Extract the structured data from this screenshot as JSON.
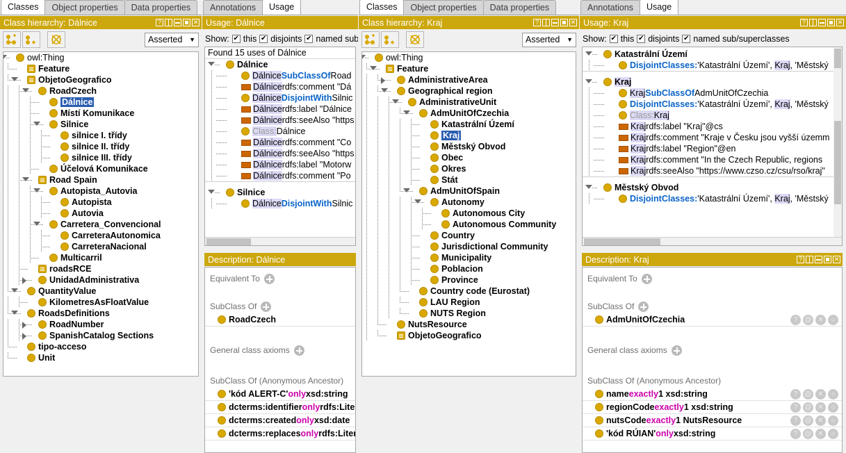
{
  "panel1": {
    "tabs": [
      {
        "label": "Classes",
        "active": true
      },
      {
        "label": "Object properties",
        "active": false
      },
      {
        "label": "Data properties",
        "active": false
      }
    ],
    "title": "Class hierarchy: Dálnice",
    "toolbar": {
      "add_subclass_icon": "add-subclass-icon",
      "add_sibling_icon": "add-sibling-class-icon",
      "delete_icon": "delete-class-icon",
      "reasoner_mode": "Asserted"
    },
    "tree": [
      {
        "label": "owl:Thing",
        "depth": 0,
        "arrow": "down",
        "node": "class",
        "bold": false
      },
      {
        "label": "Feature",
        "depth": 1,
        "arrow": "",
        "node": "defined",
        "bold": true
      },
      {
        "label": "ObjetoGeografico",
        "depth": 1,
        "arrow": "down",
        "node": "defined",
        "bold": true
      },
      {
        "label": "RoadCzech",
        "depth": 2,
        "arrow": "down",
        "node": "class",
        "bold": true
      },
      {
        "label": "Dálnice",
        "depth": 3,
        "arrow": "",
        "node": "class",
        "bold": true,
        "selected": true
      },
      {
        "label": "Místí Komunikace",
        "depth": 3,
        "arrow": "",
        "node": "class",
        "bold": true
      },
      {
        "label": "Silnice",
        "depth": 3,
        "arrow": "down",
        "node": "class",
        "bold": true
      },
      {
        "label": "silnice I. třídy",
        "depth": 4,
        "arrow": "",
        "node": "class",
        "bold": true
      },
      {
        "label": "silnice II. třídy",
        "depth": 4,
        "arrow": "",
        "node": "class",
        "bold": true
      },
      {
        "label": "silnice III. třídy",
        "depth": 4,
        "arrow": "",
        "node": "class",
        "bold": true
      },
      {
        "label": "Účelová Komunikace",
        "depth": 3,
        "arrow": "",
        "node": "class",
        "bold": true
      },
      {
        "label": "Road Spain",
        "depth": 2,
        "arrow": "down",
        "node": "defined",
        "bold": true
      },
      {
        "label": "Autopista_Autovia",
        "depth": 3,
        "arrow": "down",
        "node": "class",
        "bold": true
      },
      {
        "label": "Autopista",
        "depth": 4,
        "arrow": "",
        "node": "class",
        "bold": true
      },
      {
        "label": "Autovia",
        "depth": 4,
        "arrow": "",
        "node": "class",
        "bold": true
      },
      {
        "label": "Carretera_Convencional",
        "depth": 3,
        "arrow": "down",
        "node": "class",
        "bold": true
      },
      {
        "label": "CarreteraAutonomica",
        "depth": 4,
        "arrow": "",
        "node": "class",
        "bold": true
      },
      {
        "label": "CarreteraNacional",
        "depth": 4,
        "arrow": "",
        "node": "class",
        "bold": true
      },
      {
        "label": "Multicarril",
        "depth": 3,
        "arrow": "",
        "node": "class",
        "bold": true
      },
      {
        "label": "roadsRCE",
        "depth": 2,
        "arrow": "",
        "node": "defined",
        "bold": true
      },
      {
        "label": "UnidadAdministrativa",
        "depth": 2,
        "arrow": "right",
        "node": "class",
        "bold": true
      },
      {
        "label": "QuantityValue",
        "depth": 1,
        "arrow": "down",
        "node": "class",
        "bold": true
      },
      {
        "label": "KilometresAsFloatValue",
        "depth": 2,
        "arrow": "",
        "node": "class",
        "bold": true
      },
      {
        "label": "RoadsDefinitions",
        "depth": 1,
        "arrow": "down",
        "node": "class",
        "bold": true
      },
      {
        "label": "RoadNumber",
        "depth": 2,
        "arrow": "right",
        "node": "class",
        "bold": true
      },
      {
        "label": "SpanishCatalog Sections",
        "depth": 2,
        "arrow": "right",
        "node": "class",
        "bold": true
      },
      {
        "label": "tipo-acceso",
        "depth": 1,
        "arrow": "",
        "node": "class",
        "bold": true
      },
      {
        "label": "Unit",
        "depth": 1,
        "arrow": "",
        "node": "class",
        "bold": true
      }
    ]
  },
  "panel2": {
    "tabs": [
      {
        "label": "Annotations",
        "active": false
      },
      {
        "label": "Usage",
        "active": true
      }
    ],
    "title": "Usage: Dálnice",
    "show": {
      "label": "Show:",
      "opt1": "this",
      "opt2": "disjoints",
      "opt3": "named sub",
      "check": "✔"
    },
    "found": "Found 15 uses of Dálnice",
    "found_term": "Dálnice",
    "rows": [
      {
        "kind": "group",
        "label": "Dálnice",
        "arrow": "down"
      },
      {
        "kind": "axiom",
        "node": "class",
        "subj": "Dálnice",
        "kw": "SubClassOf",
        "rest": "Road"
      },
      {
        "kind": "axiom",
        "node": "anno",
        "subj": "Dálnice",
        "kw": "",
        "rest": "rdfs:comment \"Dá"
      },
      {
        "kind": "axiom",
        "node": "class",
        "subj": "Dálnice",
        "kw": "DisjointWith",
        "rest": "Silnic"
      },
      {
        "kind": "axiom",
        "node": "anno",
        "subj": "Dálnice",
        "kw": "",
        "rest": "rdfs:label \"Dálnice"
      },
      {
        "kind": "axiom",
        "node": "anno",
        "subj": "Dálnice",
        "kw": "",
        "rest": "rdfs:seeAlso \"https"
      },
      {
        "kind": "axiom",
        "node": "class",
        "subj": "Class:",
        "kw": "",
        "rest": "Dálnice",
        "light": true
      },
      {
        "kind": "axiom",
        "node": "anno",
        "subj": "Dálnice",
        "kw": "",
        "rest": "rdfs:comment \"Co"
      },
      {
        "kind": "axiom",
        "node": "anno",
        "subj": "Dálnice",
        "kw": "",
        "rest": "rdfs:seeAlso \"https"
      },
      {
        "kind": "axiom",
        "node": "anno",
        "subj": "Dálnice",
        "kw": "",
        "rest": "rdfs:label \"Motorw"
      },
      {
        "kind": "axiom",
        "node": "anno",
        "subj": "Dálnice",
        "kw": "",
        "rest": "rdfs:comment \"Po"
      },
      {
        "kind": "sep"
      },
      {
        "kind": "group",
        "label": "Silnice",
        "arrow": "down"
      },
      {
        "kind": "axiom",
        "node": "class",
        "subj": "Dálnice",
        "kw": "DisjointWith",
        "rest": "Silnic"
      }
    ]
  },
  "panel2desc": {
    "title": "Description: Dálnice",
    "sections": {
      "equivalent_to": "Equivalent To",
      "subclass_of": "SubClass Of",
      "general_class_axioms": "General class axioms",
      "anon_ancestor": "SubClass Of (Anonymous Ancestor)"
    },
    "subclass_rows": [
      {
        "label": "RoadCzech"
      }
    ],
    "anon_rows": [
      {
        "prefix": "'kód ALERT-C'",
        "kw": "only",
        "suffix": "xsd:string"
      },
      {
        "prefix": "dcterms:identifier",
        "kw": "only",
        "suffix": "rdfs:Liter"
      },
      {
        "prefix": "dcterms:created",
        "kw": "only",
        "suffix": "xsd:date"
      },
      {
        "prefix": "dcterms:replaces",
        "kw": "only",
        "suffix": "rdfs:Liter"
      }
    ]
  },
  "panel3": {
    "tabs": [
      {
        "label": "Classes",
        "active": true
      },
      {
        "label": "Object properties",
        "active": false
      },
      {
        "label": "Data properties",
        "active": false
      }
    ],
    "title": "Class hierarchy: Kraj",
    "toolbar": {
      "add_subclass_icon": "add-subclass-icon",
      "add_sibling_icon": "add-sibling-class-icon",
      "delete_icon": "delete-class-icon",
      "reasoner_mode": "Asserted"
    },
    "tree": [
      {
        "label": "owl:Thing",
        "depth": 0,
        "arrow": "down",
        "node": "class",
        "bold": false
      },
      {
        "label": "Feature",
        "depth": 1,
        "arrow": "down",
        "node": "defined",
        "bold": true
      },
      {
        "label": "AdministrativeArea",
        "depth": 2,
        "arrow": "right",
        "node": "class",
        "bold": true
      },
      {
        "label": "Geographical region",
        "depth": 2,
        "arrow": "down",
        "node": "class",
        "bold": true
      },
      {
        "label": "AdministrativeUnit",
        "depth": 3,
        "arrow": "down",
        "node": "class",
        "bold": true
      },
      {
        "label": "AdmUnitOfCzechia",
        "depth": 4,
        "arrow": "down",
        "node": "class",
        "bold": true
      },
      {
        "label": "Katastrální Území",
        "depth": 5,
        "arrow": "",
        "node": "class",
        "bold": true
      },
      {
        "label": "Kraj",
        "depth": 5,
        "arrow": "",
        "node": "class",
        "bold": true,
        "selected": true
      },
      {
        "label": "Městský Obvod",
        "depth": 5,
        "arrow": "",
        "node": "class",
        "bold": true
      },
      {
        "label": "Obec",
        "depth": 5,
        "arrow": "",
        "node": "class",
        "bold": true
      },
      {
        "label": "Okres",
        "depth": 5,
        "arrow": "",
        "node": "class",
        "bold": true
      },
      {
        "label": "Stát",
        "depth": 5,
        "arrow": "",
        "node": "class",
        "bold": true
      },
      {
        "label": "AdmUnitOfSpain",
        "depth": 4,
        "arrow": "down",
        "node": "class",
        "bold": true
      },
      {
        "label": "Autonomy",
        "depth": 5,
        "arrow": "down",
        "node": "class",
        "bold": true
      },
      {
        "label": "Autonomous City",
        "depth": 6,
        "arrow": "",
        "node": "class",
        "bold": true
      },
      {
        "label": "Autonomous Community",
        "depth": 6,
        "arrow": "",
        "node": "class",
        "bold": true
      },
      {
        "label": "Country",
        "depth": 5,
        "arrow": "",
        "node": "class",
        "bold": true
      },
      {
        "label": "Jurisdictional Community",
        "depth": 5,
        "arrow": "",
        "node": "class",
        "bold": true
      },
      {
        "label": "Municipality",
        "depth": 5,
        "arrow": "",
        "node": "class",
        "bold": true
      },
      {
        "label": "Poblacion",
        "depth": 5,
        "arrow": "",
        "node": "class",
        "bold": true
      },
      {
        "label": "Province",
        "depth": 5,
        "arrow": "",
        "node": "class",
        "bold": true
      },
      {
        "label": "Country code (Eurostat)",
        "depth": 4,
        "arrow": "",
        "node": "class",
        "bold": true
      },
      {
        "label": "LAU Region",
        "depth": 4,
        "arrow": "",
        "node": "class",
        "bold": true
      },
      {
        "label": "NUTS Region",
        "depth": 4,
        "arrow": "",
        "node": "class",
        "bold": true
      },
      {
        "label": "NutsResource",
        "depth": 2,
        "arrow": "",
        "node": "class",
        "bold": true
      },
      {
        "label": "ObjetoGeografico",
        "depth": 2,
        "arrow": "",
        "node": "defined",
        "bold": true
      }
    ]
  },
  "panel4": {
    "tabs": [
      {
        "label": "Annotations",
        "active": false
      },
      {
        "label": "Usage",
        "active": true
      }
    ],
    "title": "Usage: Kraj",
    "show": {
      "label": "Show:",
      "opt1": "this",
      "opt2": "disjoints",
      "opt3": "named sub/superclasses",
      "check": "✔"
    },
    "rows": [
      {
        "kind": "group",
        "label": "Katastrální Území",
        "arrow": "down"
      },
      {
        "kind": "axiom",
        "node": "class",
        "subj": "",
        "kw": "DisjointClasses:",
        "rest": "'Katastrální Území', Kraj, 'Městský",
        "hlword": "Kraj"
      },
      {
        "kind": "sep"
      },
      {
        "kind": "group",
        "label": "Kraj",
        "arrow": "down",
        "hl": true
      },
      {
        "kind": "axiom",
        "node": "class",
        "subj": "Kraj",
        "kw": "SubClassOf",
        "rest": "AdmUnitOfCzechia"
      },
      {
        "kind": "axiom",
        "node": "class",
        "subj": "",
        "kw": "DisjointClasses:",
        "rest": "'Katastrální Území', Kraj, 'Městský",
        "hlword": "Kraj"
      },
      {
        "kind": "axiom",
        "node": "class",
        "subj": "Class:",
        "kw": "",
        "rest": "Kraj",
        "light": true,
        "hlword": "Kraj"
      },
      {
        "kind": "axiom",
        "node": "anno",
        "subj": "Kraj",
        "kw": "",
        "rest": "rdfs:label \"Kraj\"@cs"
      },
      {
        "kind": "axiom",
        "node": "anno",
        "subj": "Kraj",
        "kw": "",
        "rest": "rdfs:comment \"Kraje v Česku jsou vyšší územm"
      },
      {
        "kind": "axiom",
        "node": "anno",
        "subj": "Kraj",
        "kw": "",
        "rest": "rdfs:label \"Region\"@en"
      },
      {
        "kind": "axiom",
        "node": "anno",
        "subj": "Kraj",
        "kw": "",
        "rest": "rdfs:comment \"In the Czech Republic, regions "
      },
      {
        "kind": "axiom",
        "node": "anno",
        "subj": "Kraj",
        "kw": "",
        "rest": "rdfs:seeAlso \"https://www.czso.cz/csu/rso/kraj\""
      },
      {
        "kind": "sep"
      },
      {
        "kind": "group",
        "label": "Městský Obvod",
        "arrow": "down"
      },
      {
        "kind": "axiom",
        "node": "class",
        "subj": "",
        "kw": "DisjointClasses:",
        "rest": "'Katastrální Území', Kraj, 'Městský",
        "hlword": "Kraj"
      }
    ]
  },
  "panel4desc": {
    "title": "Description: Kraj",
    "sections": {
      "equivalent_to": "Equivalent To",
      "subclass_of": "SubClass Of",
      "general_class_axioms": "General class axioms",
      "anon_ancestor": "SubClass Of (Anonymous Ancestor)"
    },
    "row_buttons": [
      "?",
      "@",
      "✕",
      "○"
    ],
    "subclass_rows": [
      {
        "label": "AdmUnitOfCzechia"
      }
    ],
    "anon_rows": [
      {
        "prefix": "name",
        "kw": "exactly",
        "suffix": "1 xsd:string"
      },
      {
        "prefix": "regionCode",
        "kw": "exactly",
        "suffix": "1 xsd:string"
      },
      {
        "prefix": "nutsCode",
        "kw": "exactly",
        "suffix": "1 NutsResource"
      },
      {
        "prefix": "'kód RÚIAN'",
        "kw": "only",
        "suffix": "xsd:string"
      }
    ]
  },
  "colors": {
    "title_bar": "#cca70d",
    "node_yellow": "#d9a900",
    "anno_orange": "#cc6600",
    "keyword_blue": "#0a64c8",
    "keyword_magenta": "#cc00aa",
    "selection_blue": "#2a5db0",
    "usage_highlight": "#dcd9f5"
  }
}
